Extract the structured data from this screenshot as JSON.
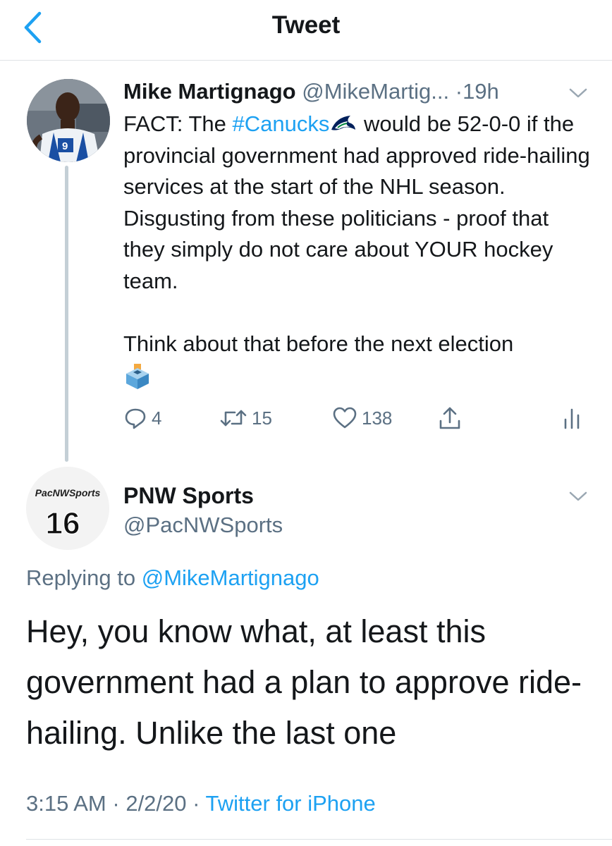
{
  "header": {
    "title": "Tweet",
    "back_icon": "chevron-left-icon"
  },
  "colors": {
    "accent": "#1da1f2",
    "secondary_text": "#5b7083",
    "primary_text": "#14171a",
    "divider": "#dfe3e6"
  },
  "parent_tweet": {
    "display_name": "Mike Martignago",
    "handle": "@MikeMartig...",
    "separator": "·",
    "time": "19h",
    "body": {
      "line1_before": "FACT: The ",
      "hashtag": "#Canucks",
      "hashtag_emoji": "canucks-orca-logo",
      "line1_after": " would be 52-0-0 if the provincial government had approved ride-hailing services at the start of the NHL season. Disgusting from these politicians - proof that they simply do not care about YOUR hockey team.",
      "paragraph2": "Think about that before the next election",
      "emoji": "ballot-box-emoji"
    },
    "actions": {
      "replies": "4",
      "retweets": "15",
      "likes": "138"
    }
  },
  "reply_tweet": {
    "avatar_text_top": "PacNWSports",
    "avatar_text_number": "16",
    "display_name": "PNW Sports",
    "handle": "@PacNWSports",
    "replying_prefix": "Replying to",
    "replying_handle": "@MikeMartignago",
    "body": "Hey, you know what, at least this government had a plan to approve ride-hailing. Unlike the last one",
    "time": "3:15 AM",
    "date": "2/2/20",
    "separator": "·",
    "source": "Twitter for iPhone"
  }
}
